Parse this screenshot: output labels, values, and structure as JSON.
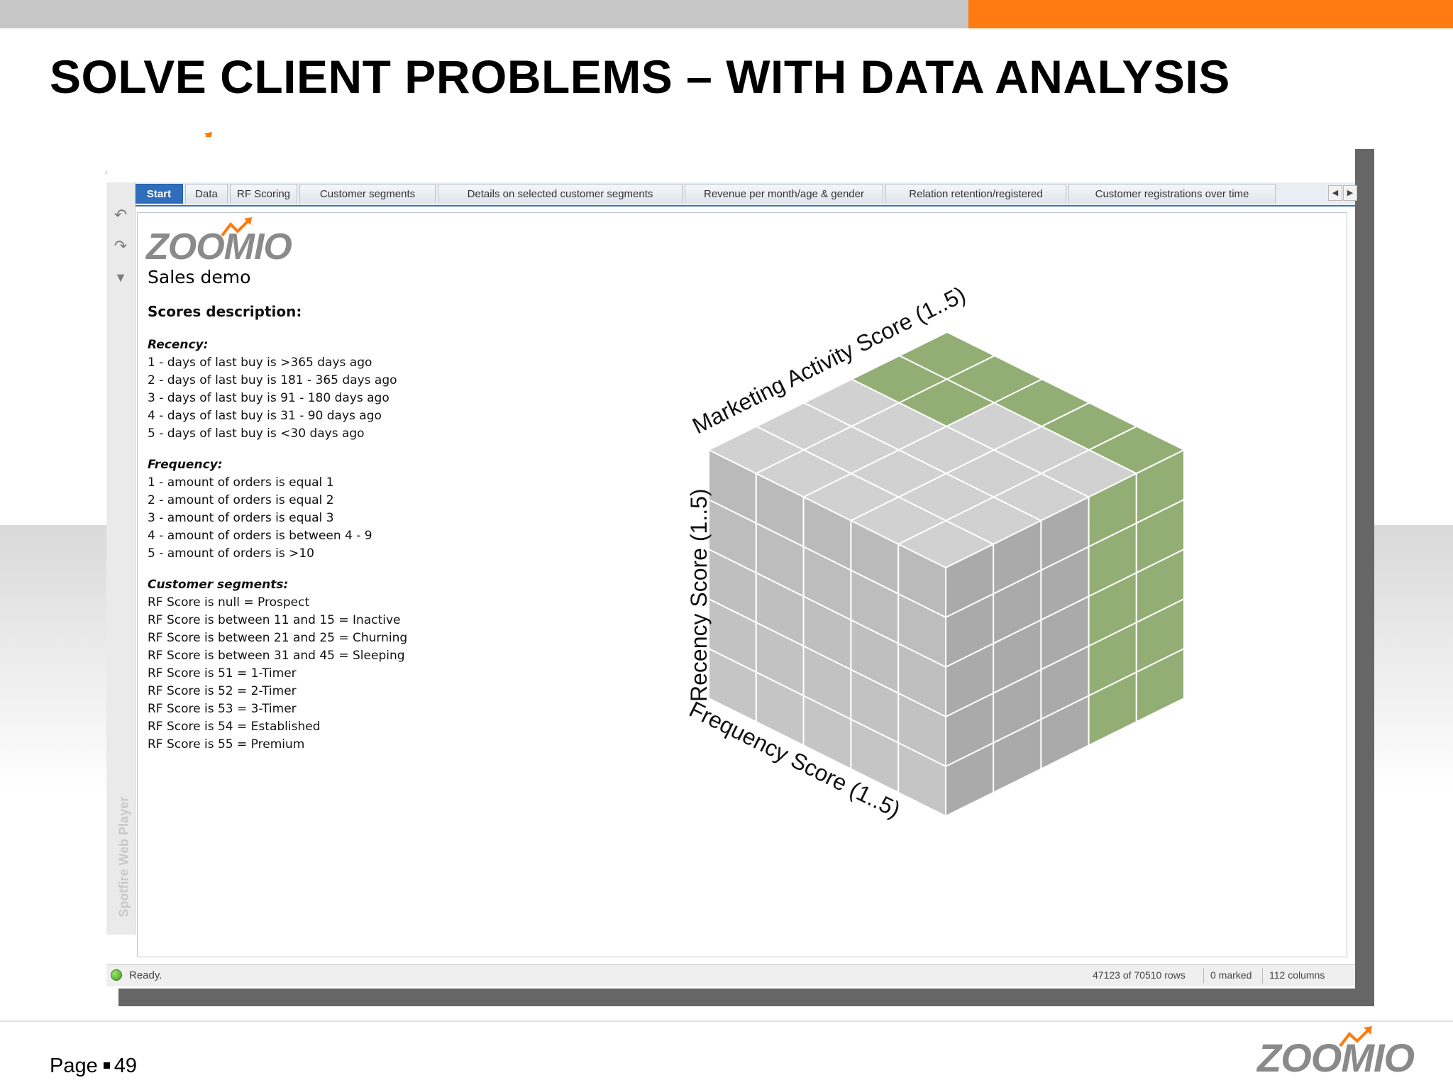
{
  "slide": {
    "title": "SOLVE CLIENT PROBLEMS – WITH DATA ANALYSIS",
    "page_label": "Page",
    "page_number": "49",
    "brand": "ZOOMIO",
    "accent_color": "#ff7a10"
  },
  "app": {
    "brand": "ZOOMIO",
    "tabs": [
      {
        "label": "Start",
        "active": true
      },
      {
        "label": "Data",
        "active": false
      },
      {
        "label": "RF Scoring",
        "active": false
      },
      {
        "label": "Customer segments",
        "active": false
      },
      {
        "label": "Details on selected customer segments",
        "active": false
      },
      {
        "label": "Revenue per month/age & gender",
        "active": false
      },
      {
        "label": "Relation retention/registered",
        "active": false
      },
      {
        "label": "Customer registrations over time",
        "active": false
      }
    ],
    "side_label": "Spotfire Web Player",
    "tools": [
      "undo-icon",
      "redo-icon",
      "bookmark-icon"
    ]
  },
  "page": {
    "title": "Sales demo",
    "scores_heading": "Scores description:",
    "recency": {
      "heading": "Recency:",
      "items": [
        "1 - days of last buy is >365 days ago",
        "2 - days of last buy is 181 - 365 days ago",
        "3 - days of last buy is 91 - 180 days ago",
        "4 - days of last buy is 31 - 90 days ago",
        "5 - days of last buy is <30 days ago"
      ]
    },
    "frequency": {
      "heading": "Frequency:",
      "items": [
        "1 - amount of orders is equal 1",
        "2 - amount of orders is equal 2",
        "3 - amount of orders is equal 3",
        "4 - amount of orders is between 4 - 9",
        "5 - amount of orders is >10"
      ]
    },
    "segments": {
      "heading": "Customer segments:",
      "items": [
        "RF Score is null = Prospect",
        "RF Score is between 11 and 15 = Inactive",
        "RF Score is between 21 and 25 = Churning",
        "RF Score is between 31 and 45 = Sleeping",
        "RF Score is 51 = 1-Timer",
        "RF Score is 52 = 2-Timer",
        "RF Score is 53 = 3-Timer",
        "RF Score is 54 = Established",
        "RF Score is 55 = Premium"
      ]
    },
    "cube": {
      "axis_marketing": "Marketing Activity Score (1..5)",
      "axis_recency": "Recency Score (1..5)",
      "axis_frequency": "Frequency Score (1..5)",
      "grid": 5,
      "highlight_color": "#6f9347",
      "base_color": "#9a9a9a"
    }
  },
  "status": {
    "text": "Ready.",
    "rows": "47123 of 70510 rows",
    "marked": "0 marked",
    "columns": "112 columns"
  }
}
